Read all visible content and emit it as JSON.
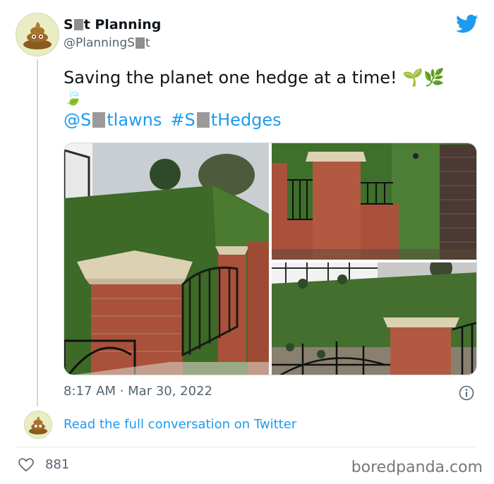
{
  "author": {
    "name_pre": "S",
    "name_post": "t Planning",
    "handle_pre": "@PlanningS",
    "handle_post": "t"
  },
  "tweet": {
    "text": "Saving the planet one hedge at a time! 🌱🌿",
    "emoji_line": "🍃",
    "mention_pre": "@S",
    "mention_post": "tlawns",
    "hashtag_pre": "#S",
    "hashtag_post": "tHedges"
  },
  "timestamp": "8:17 AM · Mar 30, 2022",
  "read_more": "Read the full conversation on Twitter",
  "likes": "881",
  "watermark": "boredpanda.com",
  "colors": {
    "link": "#1d9bf0",
    "hedge": "#3f6b2a",
    "brick": "#a9513a",
    "muted": "#536471"
  },
  "icons": {
    "brand": "twitter-bird-icon",
    "avatar": "poop-emoji-icon",
    "info": "info-icon",
    "like": "heart-icon"
  }
}
